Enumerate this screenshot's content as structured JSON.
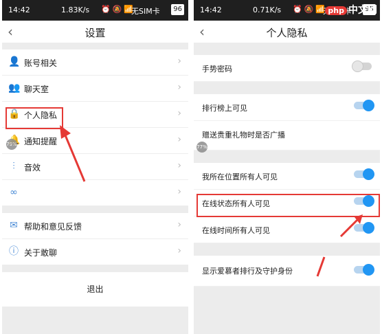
{
  "left": {
    "status": {
      "time": "14:42",
      "net": "1.83K/s",
      "carrier": "无SIM卡",
      "battery": "96"
    },
    "title": "设置",
    "items": [
      {
        "label": "账号相关",
        "icon": "user-icon"
      },
      {
        "label": "聊天室",
        "icon": "users-icon"
      },
      {
        "label": "个人隐私",
        "icon": "lock-icon"
      },
      {
        "label": "通知提醒",
        "icon": "bell-icon"
      },
      {
        "label": "音效",
        "icon": "equalizer-icon"
      },
      {
        "label": "",
        "icon": "link-icon"
      },
      {
        "label": "帮助和意见反馈",
        "icon": "mail-icon"
      },
      {
        "label": "关于敢聊",
        "icon": "info-icon"
      }
    ],
    "logout": "退出",
    "bubble": "79%"
  },
  "right": {
    "status": {
      "time": "14:42",
      "net": "0.71K/s",
      "carrier": "无SIM卡",
      "battery": "95"
    },
    "title": "个人隐私",
    "rows": [
      {
        "label": "手势密码",
        "on": false
      },
      {
        "label": "排行榜上可见",
        "on": true
      },
      {
        "label": "赠送贵重礼物时是否广播",
        "on": true
      },
      {
        "label": "我所在位置所有人可见",
        "on": true
      },
      {
        "label": "在线状态所有人可见",
        "on": true
      },
      {
        "label": "在线时间所有人可见",
        "on": true
      },
      {
        "label": "显示爱慕者排行及守护身份",
        "on": true
      }
    ],
    "bubble": "77%",
    "watermark": {
      "badge": "php",
      "text": "中文网"
    }
  },
  "colors": {
    "accent": "#2196f3",
    "annotation": "#e53935"
  }
}
